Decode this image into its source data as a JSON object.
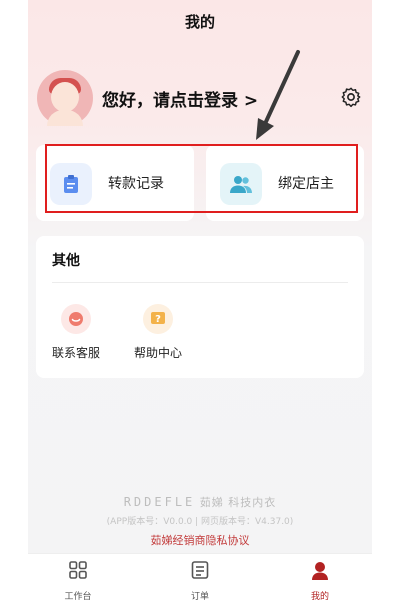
{
  "header": {
    "title": "我的"
  },
  "profile": {
    "greeting": "您好，请点击登录 >"
  },
  "quick_actions": [
    {
      "label": "转款记录",
      "icon": "clipboard-icon",
      "color": "#5b8def"
    },
    {
      "label": "绑定店主",
      "icon": "users-icon",
      "color": "#3aa7c9"
    }
  ],
  "other": {
    "title": "其他",
    "items": [
      {
        "label": "联系客服",
        "icon": "customer-service-icon"
      },
      {
        "label": "帮助中心",
        "icon": "help-icon"
      }
    ]
  },
  "footer": {
    "brand_logo": "RDDEFLE",
    "brand_text": "茹娣 科技内衣",
    "version": "(APP版本号：V0.0.0 | 网页版本号：V4.37.0)",
    "privacy": "茹娣经销商隐私协议"
  },
  "tabs": [
    {
      "label": "工作台",
      "icon": "grid-icon"
    },
    {
      "label": "订单",
      "icon": "order-icon"
    },
    {
      "label": "我的",
      "icon": "user-icon",
      "active": true
    }
  ],
  "colors": {
    "accent": "#b22222",
    "highlight": "#e01e1e"
  }
}
